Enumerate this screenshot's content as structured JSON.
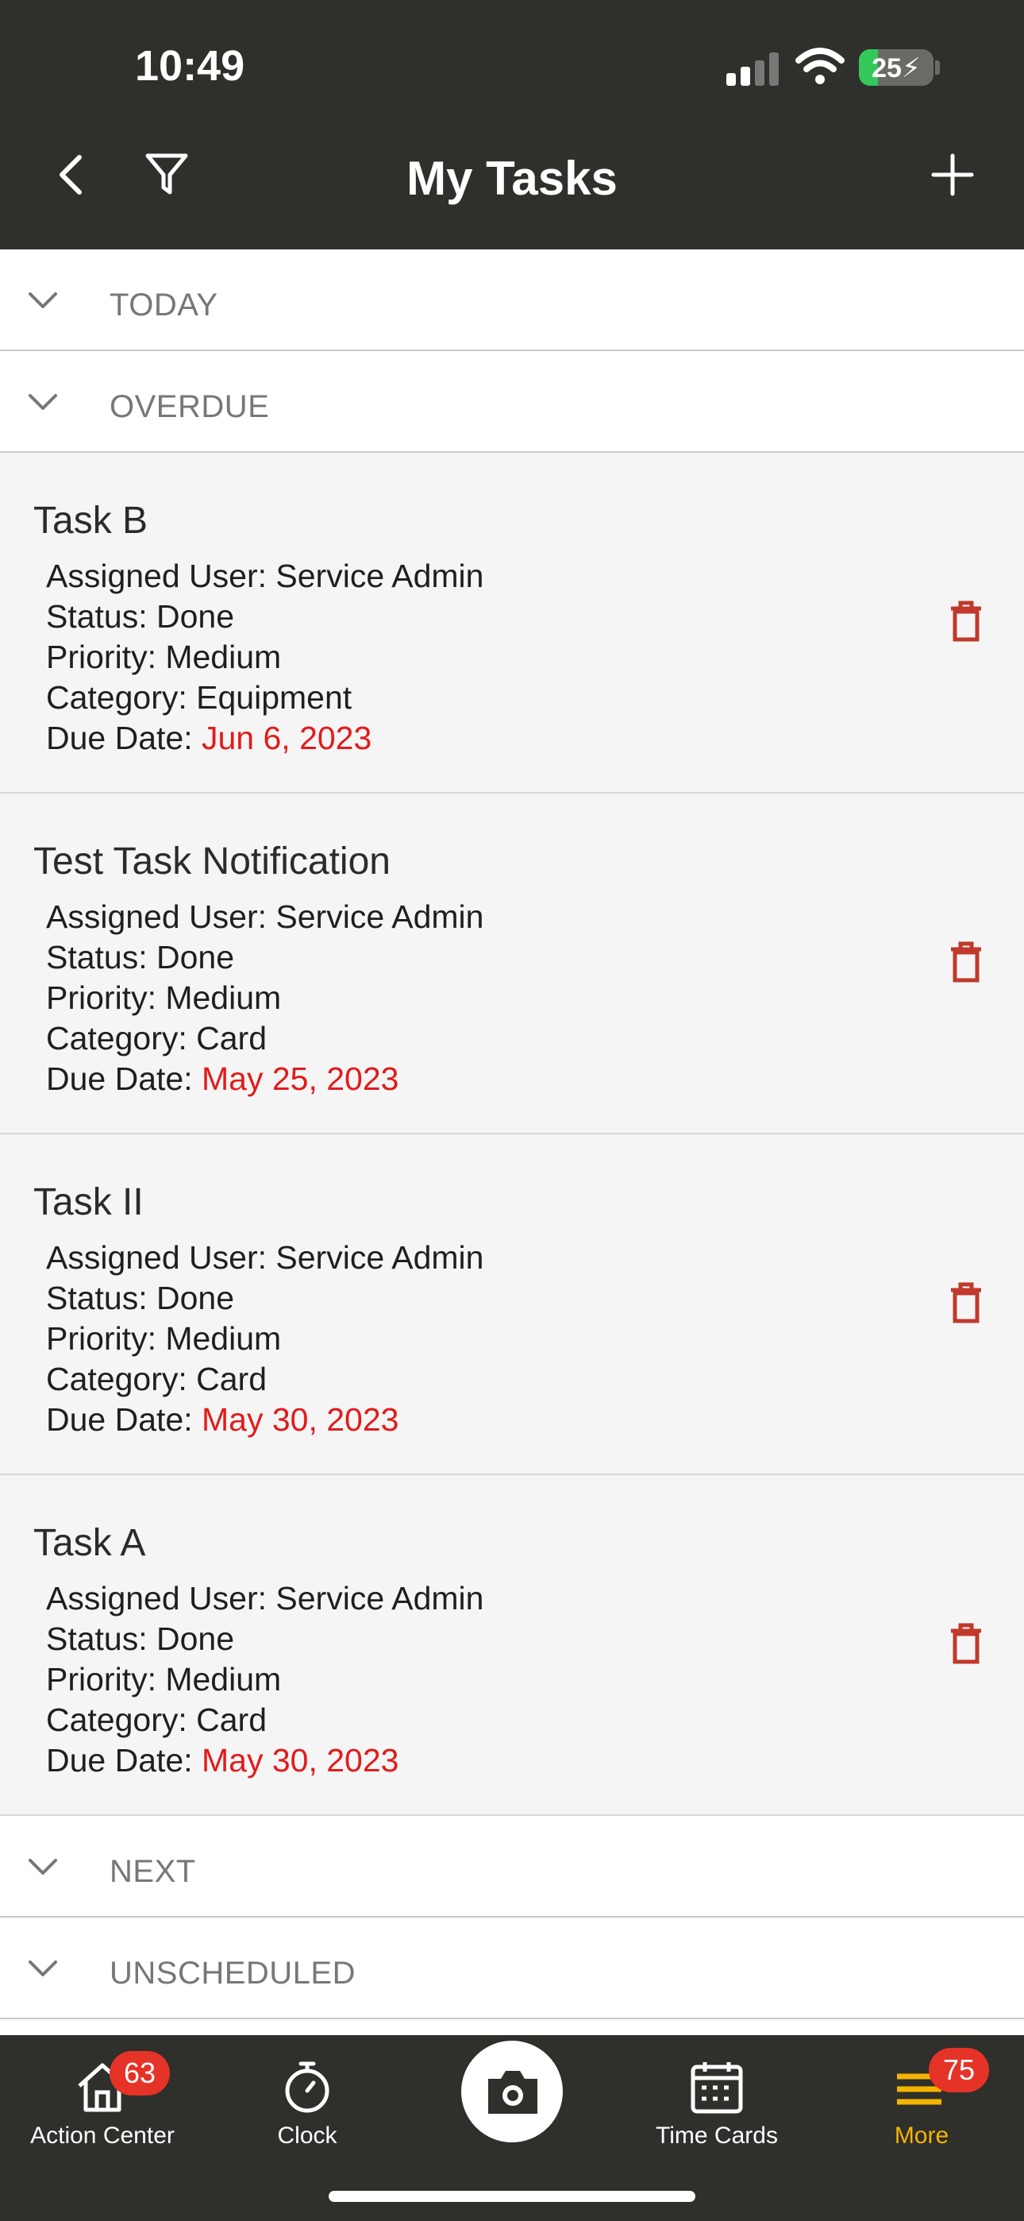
{
  "status_bar": {
    "time": "10:49",
    "battery": "25"
  },
  "header": {
    "title": "My Tasks"
  },
  "sections": {
    "today": "TODAY",
    "overdue": "OVERDUE",
    "next": "NEXT",
    "unscheduled": "UNSCHEDULED"
  },
  "tasks": [
    {
      "title": "Task B",
      "assigned": "Assigned User: Service Admin",
      "status": "Status: Done",
      "priority": "Priority: Medium",
      "category": "Category: Equipment",
      "due_label": "Due Date: ",
      "due_date": "Jun 6, 2023"
    },
    {
      "title": "Test Task Notification",
      "assigned": "Assigned User: Service Admin",
      "status": "Status: Done",
      "priority": "Priority: Medium",
      "category": "Category: Card",
      "due_label": "Due Date: ",
      "due_date": "May 25, 2023"
    },
    {
      "title": "Task II",
      "assigned": "Assigned User: Service Admin",
      "status": "Status: Done",
      "priority": "Priority: Medium",
      "category": "Category: Card",
      "due_label": "Due Date: ",
      "due_date": "May 30, 2023"
    },
    {
      "title": "Task A",
      "assigned": "Assigned User: Service Admin",
      "status": "Status: Done",
      "priority": "Priority: Medium",
      "category": "Category: Card",
      "due_label": "Due Date: ",
      "due_date": "May 30, 2023"
    }
  ],
  "tabbar": {
    "action_center": {
      "label": "Action Center",
      "badge": "63"
    },
    "clock": {
      "label": "Clock"
    },
    "camera": {
      "icon": "camera-icon"
    },
    "time_cards": {
      "label": "Time Cards"
    },
    "more": {
      "label": "More",
      "badge": "75"
    }
  },
  "colors": {
    "header_bg": "#2f2f2b",
    "overdue_date": "#e21b1b",
    "trash": "#c0392b",
    "badge": "#e53327",
    "active_tab": "#f5b400"
  }
}
